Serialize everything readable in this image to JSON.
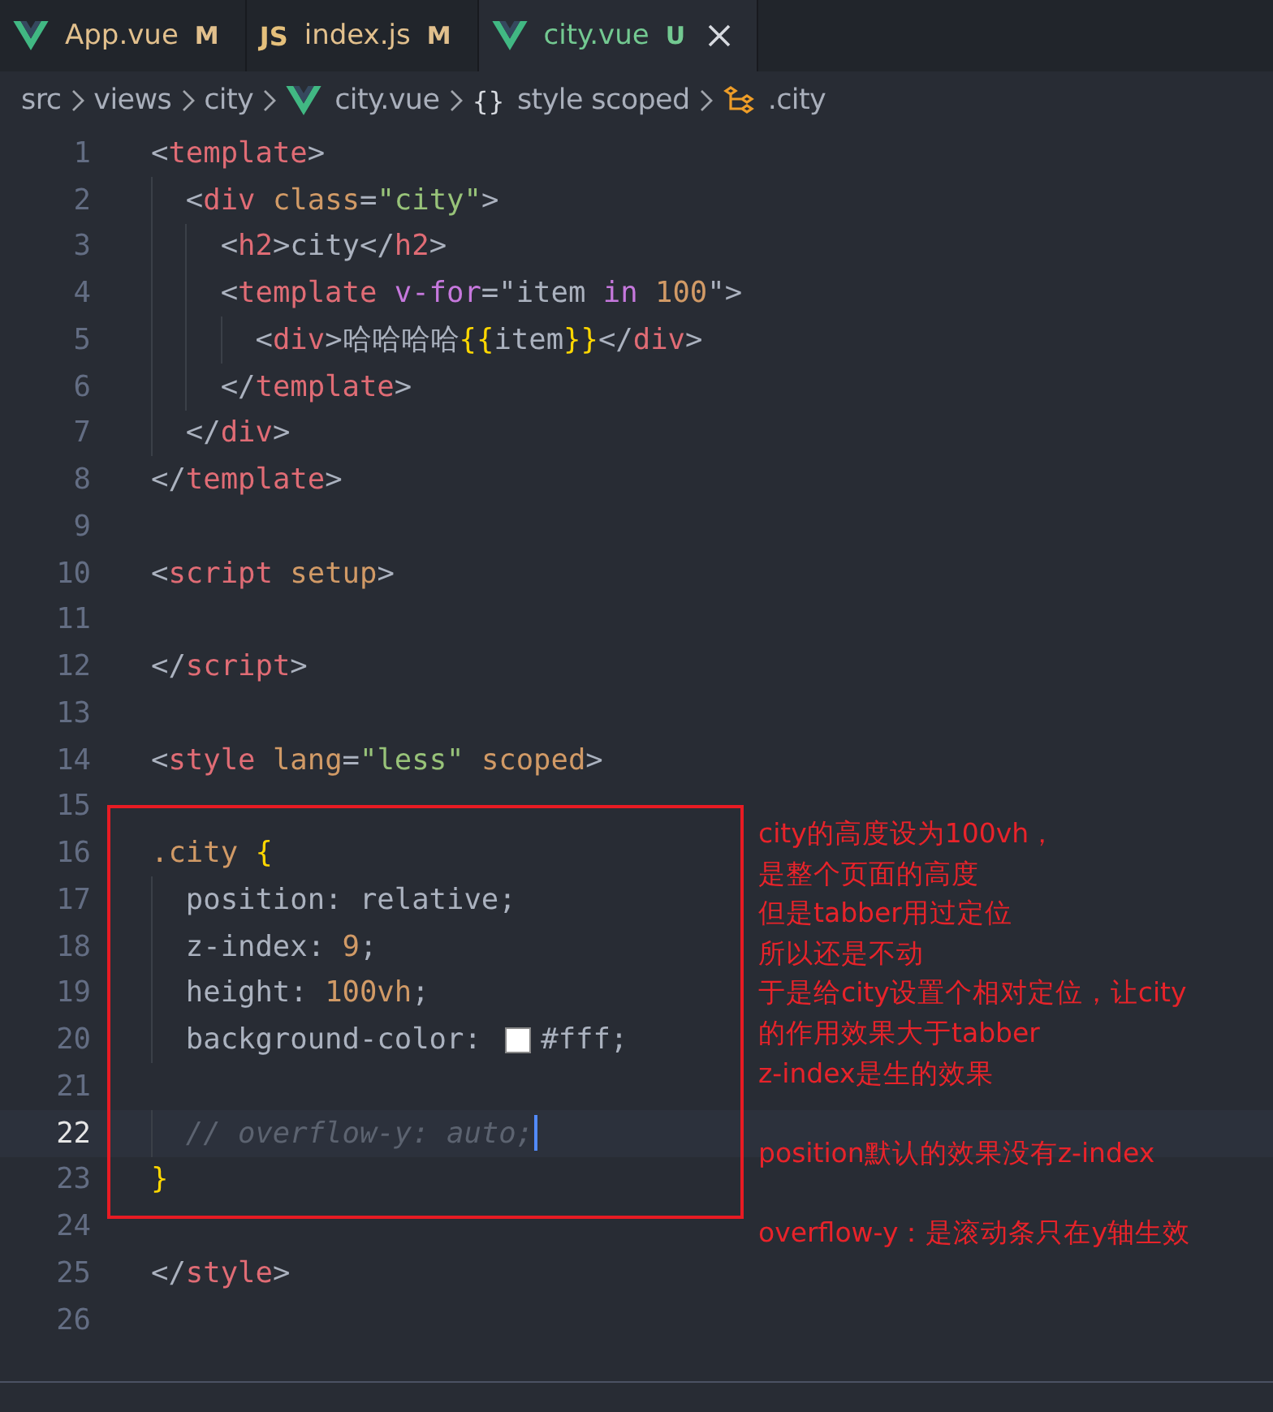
{
  "tabs": [
    {
      "label": "App.vue",
      "kind": "vue",
      "color": "#e2c08d",
      "badge": "M",
      "selected": false
    },
    {
      "label": "index.js",
      "kind": "js",
      "icon_label": "JS",
      "color": "#e2c08d",
      "badge": "M",
      "selected": false
    },
    {
      "label": "city.vue",
      "kind": "vue",
      "color": "#73c991",
      "badge": "U",
      "selected": true
    }
  ],
  "breadcrumb": [
    {
      "kind": "folder",
      "text": "src"
    },
    {
      "kind": "folder",
      "text": "views"
    },
    {
      "kind": "folder",
      "text": "city"
    },
    {
      "kind": "vue-file",
      "text": "city.vue"
    },
    {
      "kind": "block",
      "icon_label": "{}",
      "text": "style scoped"
    },
    {
      "kind": "class",
      "text": ".city"
    }
  ],
  "editor": {
    "lines": [
      {
        "number": "1",
        "active": false,
        "tokens": [
          {
            "kind": "punct",
            "text": "<"
          },
          {
            "kind": "tag",
            "text": "template"
          },
          {
            "kind": "punct",
            "text": ">"
          }
        ]
      },
      {
        "number": "2",
        "active": false,
        "tokens": [
          {
            "kind": "punct",
            "text": "  <"
          },
          {
            "kind": "tag",
            "text": "div "
          },
          {
            "kind": "attr",
            "text": "class"
          },
          {
            "kind": "punct",
            "text": "="
          },
          {
            "kind": "string",
            "text": "\"city\""
          },
          {
            "kind": "punct",
            "text": ">"
          }
        ]
      },
      {
        "number": "3",
        "active": false,
        "tokens": [
          {
            "kind": "punct",
            "text": "    <"
          },
          {
            "kind": "tag",
            "text": "h2"
          },
          {
            "kind": "punct",
            "text": ">"
          },
          {
            "kind": "text",
            "text": "city"
          },
          {
            "kind": "punct",
            "text": "</"
          },
          {
            "kind": "tag",
            "text": "h2"
          },
          {
            "kind": "punct",
            "text": ">"
          }
        ]
      },
      {
        "number": "4",
        "active": false,
        "tokens": [
          {
            "kind": "punct",
            "text": "    <"
          },
          {
            "kind": "tag",
            "text": "template "
          },
          {
            "kind": "keyword",
            "text": "v-for"
          },
          {
            "kind": "punct",
            "text": "=\""
          },
          {
            "kind": "text",
            "text": "item "
          },
          {
            "kind": "keyword",
            "text": "in "
          },
          {
            "kind": "number",
            "text": "100"
          },
          {
            "kind": "punct",
            "text": "\">"
          }
        ]
      },
      {
        "number": "5",
        "active": false,
        "tokens": [
          {
            "kind": "punct",
            "text": "      <"
          },
          {
            "kind": "tag",
            "text": "div"
          },
          {
            "kind": "punct",
            "text": ">"
          },
          {
            "kind": "text",
            "text": "哈哈哈哈"
          },
          {
            "kind": "brace",
            "text": "{{"
          },
          {
            "kind": "text",
            "text": "item"
          },
          {
            "kind": "brace",
            "text": "}}"
          },
          {
            "kind": "punct",
            "text": "</"
          },
          {
            "kind": "tag",
            "text": "div"
          },
          {
            "kind": "punct",
            "text": ">"
          }
        ]
      },
      {
        "number": "6",
        "active": false,
        "tokens": [
          {
            "kind": "punct",
            "text": "    </"
          },
          {
            "kind": "tag",
            "text": "template"
          },
          {
            "kind": "punct",
            "text": ">"
          }
        ]
      },
      {
        "number": "7",
        "active": false,
        "tokens": [
          {
            "kind": "punct",
            "text": "  </"
          },
          {
            "kind": "tag",
            "text": "div"
          },
          {
            "kind": "punct",
            "text": ">"
          }
        ]
      },
      {
        "number": "8",
        "active": false,
        "tokens": [
          {
            "kind": "punct",
            "text": "</"
          },
          {
            "kind": "tag",
            "text": "template"
          },
          {
            "kind": "punct",
            "text": ">"
          }
        ]
      },
      {
        "number": "9",
        "active": false
      },
      {
        "number": "10",
        "active": false,
        "tokens": [
          {
            "kind": "punct",
            "text": "<"
          },
          {
            "kind": "tag",
            "text": "script "
          },
          {
            "kind": "attr",
            "text": "setup"
          },
          {
            "kind": "punct",
            "text": ">"
          }
        ]
      },
      {
        "number": "11",
        "active": false
      },
      {
        "number": "12",
        "active": false,
        "tokens": [
          {
            "kind": "punct",
            "text": "</"
          },
          {
            "kind": "tag",
            "text": "script"
          },
          {
            "kind": "punct",
            "text": ">"
          }
        ]
      },
      {
        "number": "13",
        "active": false
      },
      {
        "number": "14",
        "active": false,
        "tokens": [
          {
            "kind": "punct",
            "text": "<"
          },
          {
            "kind": "tag",
            "text": "style "
          },
          {
            "kind": "attr",
            "text": "lang"
          },
          {
            "kind": "punct",
            "text": "="
          },
          {
            "kind": "string",
            "text": "\"less\" "
          },
          {
            "kind": "attr",
            "text": "scoped"
          },
          {
            "kind": "punct",
            "text": ">"
          }
        ]
      },
      {
        "number": "15",
        "active": false
      },
      {
        "number": "16",
        "active": false,
        "tokens": [
          {
            "kind": "selector",
            "text": ".city "
          },
          {
            "kind": "brace",
            "text": "{"
          }
        ]
      },
      {
        "number": "17",
        "active": false,
        "tokens": [
          {
            "kind": "text",
            "text": "  position: relative;"
          }
        ]
      },
      {
        "number": "18",
        "active": false,
        "tokens": [
          {
            "kind": "text",
            "text": "  z-index: "
          },
          {
            "kind": "number",
            "text": "9"
          },
          {
            "kind": "text",
            "text": ";"
          }
        ]
      },
      {
        "number": "19",
        "active": false,
        "tokens": [
          {
            "kind": "text",
            "text": "  height: "
          },
          {
            "kind": "number",
            "text": "100vh"
          },
          {
            "kind": "text",
            "text": ";"
          }
        ]
      },
      {
        "number": "20",
        "active": false,
        "tokens": [
          {
            "kind": "text",
            "text": "  background-color: "
          },
          {
            "kind": "swatch",
            "color": "#ffffff"
          },
          {
            "kind": "text",
            "text": "#fff;"
          }
        ]
      },
      {
        "number": "21",
        "active": false
      },
      {
        "number": "22",
        "active": true,
        "tokens": [
          {
            "kind": "comment",
            "text": "  // overflow-y: auto;"
          }
        ]
      },
      {
        "number": "23",
        "active": false,
        "tokens": [
          {
            "kind": "brace",
            "text": "}"
          }
        ]
      },
      {
        "number": "24",
        "active": false
      },
      {
        "number": "25",
        "active": false,
        "tokens": [
          {
            "kind": "punct",
            "text": "</"
          },
          {
            "kind": "tag",
            "text": "style"
          },
          {
            "kind": "punct",
            "text": ">"
          }
        ]
      },
      {
        "number": "26",
        "active": false
      }
    ]
  },
  "annotation": {
    "paragraphs": [
      [
        "city的高度设为100vh，",
        "是整个页面的高度",
        "但是tabber用过定位",
        "所以还是不动",
        "于是给city设置个相对定位，让city",
        "的作用效果大于tabber",
        "z-index是生的效果"
      ],
      [
        "position默认的效果没有z-index"
      ],
      [
        "overflow-y：是滚动条只在y轴生效"
      ]
    ]
  }
}
